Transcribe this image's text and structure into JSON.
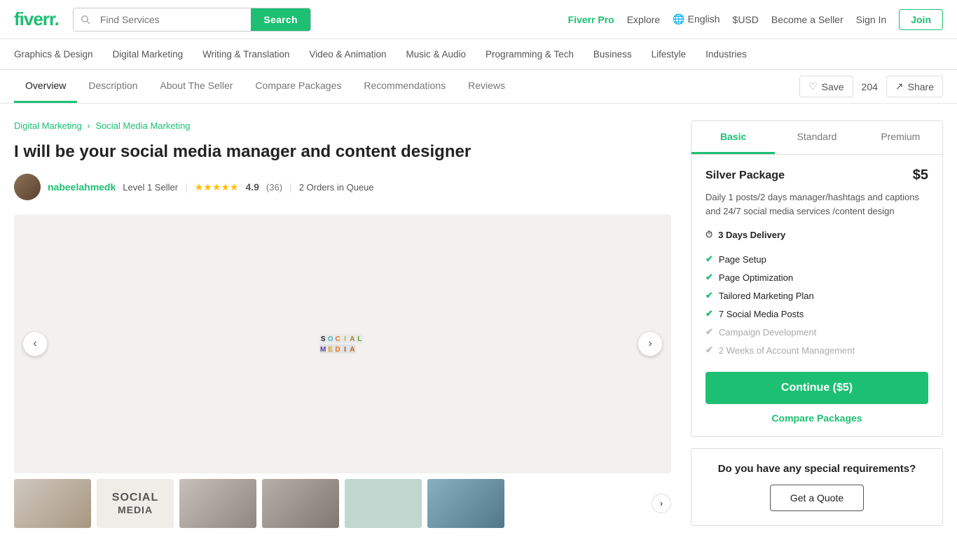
{
  "header": {
    "logo": "fiverr",
    "logo_dot": ".",
    "search_placeholder": "Find Services",
    "search_btn": "Search",
    "fiverr_pro": "Fiverr Pro",
    "explore": "Explore",
    "language": "English",
    "currency": "$USD",
    "become_seller": "Become a Seller",
    "sign_in": "Sign In",
    "join": "Join"
  },
  "categories": [
    "Graphics & Design",
    "Digital Marketing",
    "Writing & Translation",
    "Video & Animation",
    "Music & Audio",
    "Programming & Tech",
    "Business",
    "Lifestyle",
    "Industries"
  ],
  "sub_nav": {
    "items": [
      {
        "label": "Overview",
        "active": true
      },
      {
        "label": "Description",
        "active": false
      },
      {
        "label": "About The Seller",
        "active": false
      },
      {
        "label": "Compare Packages",
        "active": false
      },
      {
        "label": "Recommendations",
        "active": false
      },
      {
        "label": "Reviews",
        "active": false
      }
    ],
    "save_label": "Save",
    "save_count": "204",
    "share_label": "Share"
  },
  "breadcrumb": {
    "parent": "Digital Marketing",
    "child": "Social Media Marketing"
  },
  "gig": {
    "title": "I will be your social media manager and content designer",
    "seller_name": "nabeelahmedk",
    "seller_level": "Level 1 Seller",
    "rating": "4.9",
    "reviews_count": "(36)",
    "orders": "2 Orders in Queue"
  },
  "package": {
    "tabs": [
      "Basic",
      "Standard",
      "Premium"
    ],
    "active_tab": "Basic",
    "name": "Silver Package",
    "price": "$5",
    "description": "Daily 1 posts/2 days manager/hashtags and captions and 24/7 social media services /content design",
    "delivery": "3 Days Delivery",
    "features": [
      {
        "label": "Page Setup",
        "included": true
      },
      {
        "label": "Page Optimization",
        "included": true
      },
      {
        "label": "Tailored Marketing Plan",
        "included": true
      },
      {
        "label": "7 Social Media Posts",
        "included": true
      },
      {
        "label": "Campaign Development",
        "included": false
      },
      {
        "label": "2 Weeks of Account Management",
        "included": false
      }
    ],
    "continue_btn": "Continue ($5)",
    "compare_link": "Compare Packages"
  },
  "quote_box": {
    "title": "Do you have any special requirements?",
    "btn": "Get a Quote"
  }
}
